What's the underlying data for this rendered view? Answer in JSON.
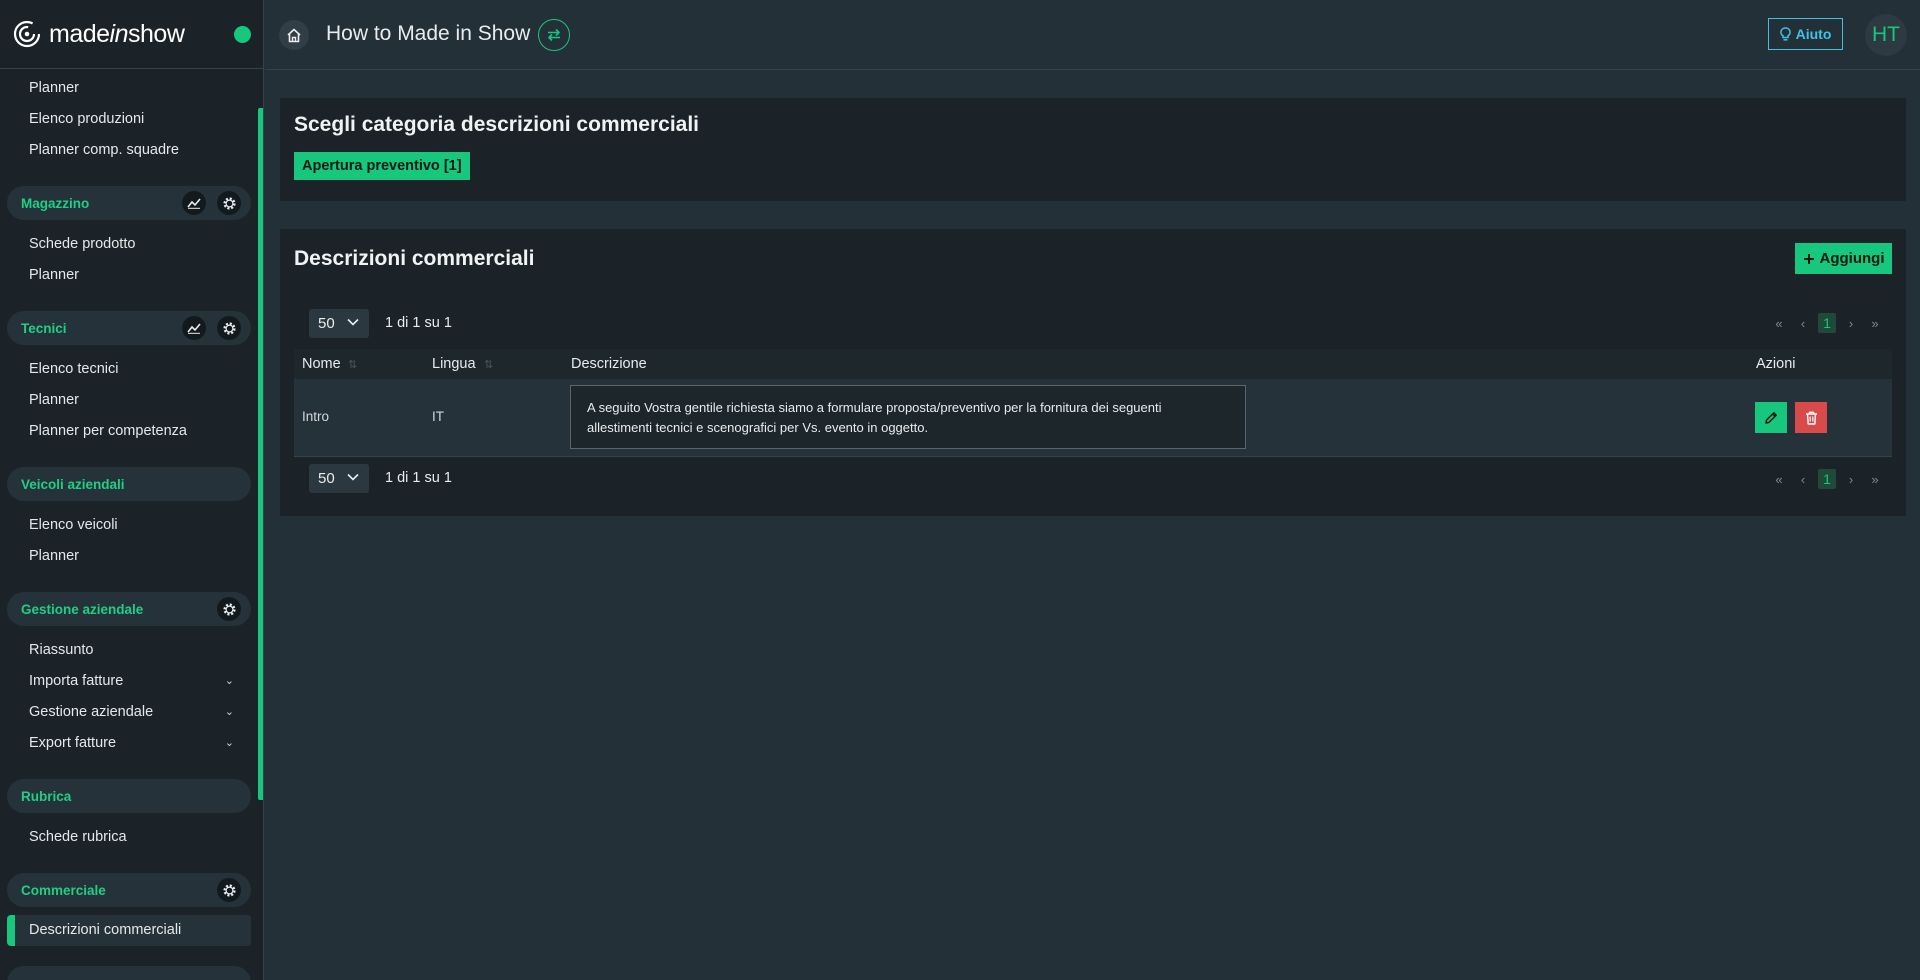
{
  "brand": {
    "logo_pre": "made",
    "logo_mid": "in",
    "logo_post": "show"
  },
  "header": {
    "title": "How to Made in Show",
    "help_label": "Aiuto",
    "avatar_initials": "HT"
  },
  "sidebar": {
    "top_items": [
      "Planner",
      "Elenco produzioni",
      "Planner comp. squadre"
    ],
    "magazzino": {
      "label": "Magazzino",
      "items": [
        "Schede prodotto",
        "Planner"
      ]
    },
    "tecnici": {
      "label": "Tecnici",
      "items": [
        "Elenco tecnici",
        "Planner",
        "Planner per competenza"
      ]
    },
    "veicoli": {
      "label": "Veicoli aziendali",
      "items": [
        "Elenco veicoli",
        "Planner"
      ]
    },
    "gestione": {
      "label": "Gestione aziendale",
      "items": [
        "Riassunto",
        "Importa fatture",
        "Gestione aziendale",
        "Export fatture"
      ]
    },
    "rubrica": {
      "label": "Rubrica",
      "items": [
        "Schede rubrica"
      ]
    },
    "commerciale": {
      "label": "Commerciale",
      "items": [
        "Descrizioni commerciali"
      ]
    }
  },
  "category_card": {
    "title": "Scegli categoria descrizioni commerciali",
    "chip": "Apertura preventivo [1]"
  },
  "list_card": {
    "title": "Descrizioni commerciali",
    "add_label": "Aggiungi",
    "page_size": "50",
    "count_text": "1 di 1 su 1",
    "current_page": "1",
    "columns": [
      "Nome",
      "Lingua",
      "Descrizione",
      "Azioni"
    ],
    "rows": [
      {
        "nome": "Intro",
        "lingua": "IT",
        "descrizione": "A seguito Vostra gentile richiesta siamo a formulare proposta/preventivo per la fornitura dei seguenti allestimenti tecnici e scenografici per Vs. evento in oggetto."
      }
    ]
  },
  "colors": {
    "accent": "#16c77d",
    "danger": "#d94a4a",
    "help": "#3fc2e8"
  }
}
